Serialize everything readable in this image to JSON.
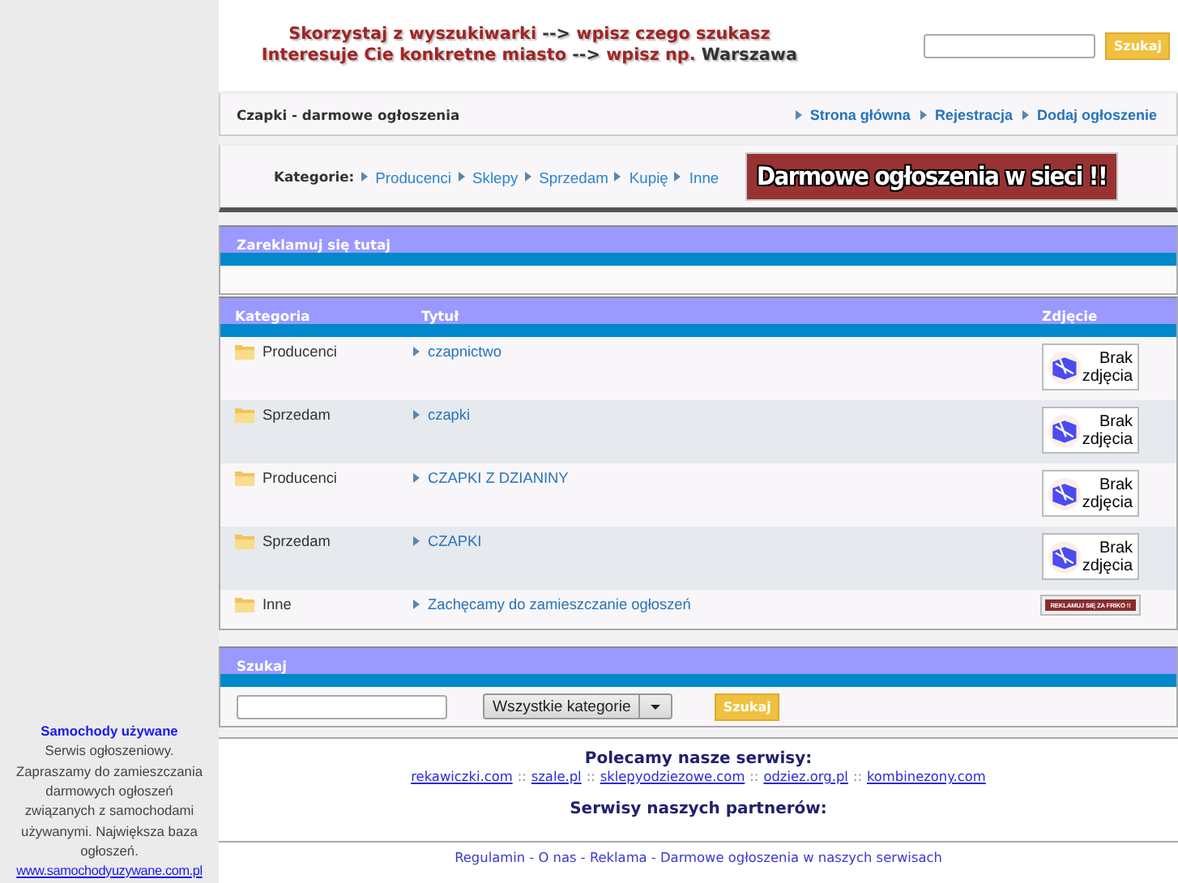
{
  "sidebar": {
    "ad": {
      "title": "Samochody używane",
      "description": "Serwis ogłoszeniowy. Zapraszamy do zamieszczania darmowych ogłoszeń związanych z samochodami używanymi. Największa baza ogłoszeń.",
      "link": "www.samochodyuzywane.com.pl"
    }
  },
  "header": {
    "headline": [
      [
        {
          "text": "Skorzystaj z wyszukiwarki",
          "highlighted": true
        },
        {
          "text": "-->",
          "highlighted": false
        },
        {
          "text": "wpisz czego szukasz",
          "highlighted": true
        }
      ],
      [
        {
          "text": "Interesuje Cie konkretne miasto",
          "highlighted": true
        },
        {
          "text": "-->",
          "highlighted": false
        },
        {
          "text": "wpisz np.",
          "highlighted": true
        },
        {
          "text": "Warszawa",
          "highlighted": false
        }
      ]
    ],
    "search_button": "Szukaj"
  },
  "title_bar": {
    "title": "Czapki - darmowe ogłoszenia",
    "nav": [
      "Strona główna",
      "Rejestracja",
      "Dodaj ogłoszenie"
    ]
  },
  "categories": {
    "label": "Kategorie:",
    "items": [
      "Producenci",
      "Sklepy",
      "Sprzedam",
      "Kupię",
      "Inne"
    ],
    "banner": "Darmowe ogłoszenia w sieci !!"
  },
  "ad_section": {
    "title": "Zareklamuj się tutaj"
  },
  "table": {
    "columns": [
      "Kategoria",
      "Tytuł",
      "Zdjęcie"
    ],
    "rows": [
      {
        "category": "Producenci",
        "title": "czapnictwo",
        "photo": {
          "kind": "placeholder",
          "text": "Brak zdjęcia"
        }
      },
      {
        "category": "Sprzedam",
        "title": "czapki",
        "photo": {
          "kind": "placeholder",
          "text": "Brak zdjęcia"
        }
      },
      {
        "category": "Producenci",
        "title": "CZAPKI Z DZIANINY",
        "photo": {
          "kind": "placeholder",
          "text": "Brak zdjęcia"
        }
      },
      {
        "category": "Sprzedam",
        "title": "CZAPKI",
        "photo": {
          "kind": "placeholder",
          "text": "Brak zdjęcia"
        }
      },
      {
        "category": "Inne",
        "title": "Zachęcamy do zamieszczanie ogłoszeń",
        "photo": {
          "kind": "banner",
          "text": "REKLAMUJ SIĘ ZA FRIKO !!"
        }
      }
    ]
  },
  "search": {
    "title": "Szukaj",
    "category_select": "Wszystkie kategorie",
    "button": "Szukaj"
  },
  "footer": {
    "services_title": "Polecamy nasze serwisy:",
    "separator": "::",
    "services": [
      "rekawiczki.com",
      "szale.pl",
      "sklepyodziezowe.com",
      "odziez.org.pl",
      "kombinezony.com"
    ],
    "partners_title": "Serwisy naszych partnerów:",
    "links_separator": "-",
    "links": [
      "Regulamin",
      "O nas",
      "Reklama",
      "Darmowe ogłoszenia w naszych serwisach"
    ]
  }
}
